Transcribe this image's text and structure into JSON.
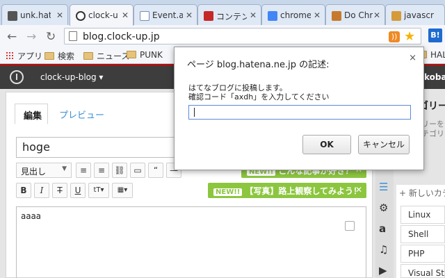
{
  "browser": {
    "tabs": [
      {
        "label": "unk.hat",
        "color": "#555555"
      },
      {
        "label": "clock-u",
        "color": "#333333",
        "active": true
      },
      {
        "label": "Event.a",
        "color": "#6f8fb8"
      },
      {
        "label": "コンテン",
        "color": "#c62828"
      },
      {
        "label": "chrome",
        "color": "#4285f4"
      },
      {
        "label": "Do Chr",
        "color": "#c77a2c"
      },
      {
        "label": "javascr",
        "color": "#d59a3a"
      }
    ],
    "url": "blog.clock-up.jp",
    "hatebu_label": "B!",
    "rss_label": "))",
    "bookmarks": [
      {
        "label": "アプリ",
        "type": "apps"
      },
      {
        "label": "検索",
        "type": "folder"
      },
      {
        "label": "ニュース",
        "type": "folder"
      },
      {
        "label": "PUNK",
        "type": "folder"
      },
      {
        "label": "HAL",
        "type": "folder"
      }
    ]
  },
  "blogbar": {
    "blog_name": "clock-up-blog ▾",
    "user": "koba"
  },
  "editor": {
    "tab_edit": "編集",
    "tab_preview": "プレビュー",
    "title_value": "hoge",
    "heading_select": "見出し",
    "body_value": "aaaa",
    "promo1": "【写真】路上観察してみよう！",
    "promo2": "こんな記事が好き？",
    "new_badge": "NEW!!",
    "promo_close": "✕",
    "toolbar_row1": [
      "≡",
      "≡",
      "⛓",
      "▭",
      "“",
      "—"
    ],
    "toolbar_row2": [
      "B",
      "I",
      "T",
      "U",
      "tT▾",
      "▦▾"
    ]
  },
  "sidebar": {
    "heading": "ゴリー",
    "sub1": "リーを",
    "sub2": "テゴリ",
    "new_category": "+ 新しいカテ",
    "categories": [
      "Linux",
      "Shell",
      "PHP",
      "Visual Stu"
    ],
    "icons": [
      "list-icon",
      "gear-icon",
      "amazon-icon",
      "music-icon",
      "video-icon"
    ]
  },
  "dialog": {
    "title": "ページ blog.hatena.ne.jp の記述:",
    "close": "×",
    "message_line1": "はてなブログに投稿します。",
    "message_line2": "確認コード「axdh」を入力してください",
    "input_value": "",
    "ok_label": "OK",
    "cancel_label": "キャンセル"
  }
}
